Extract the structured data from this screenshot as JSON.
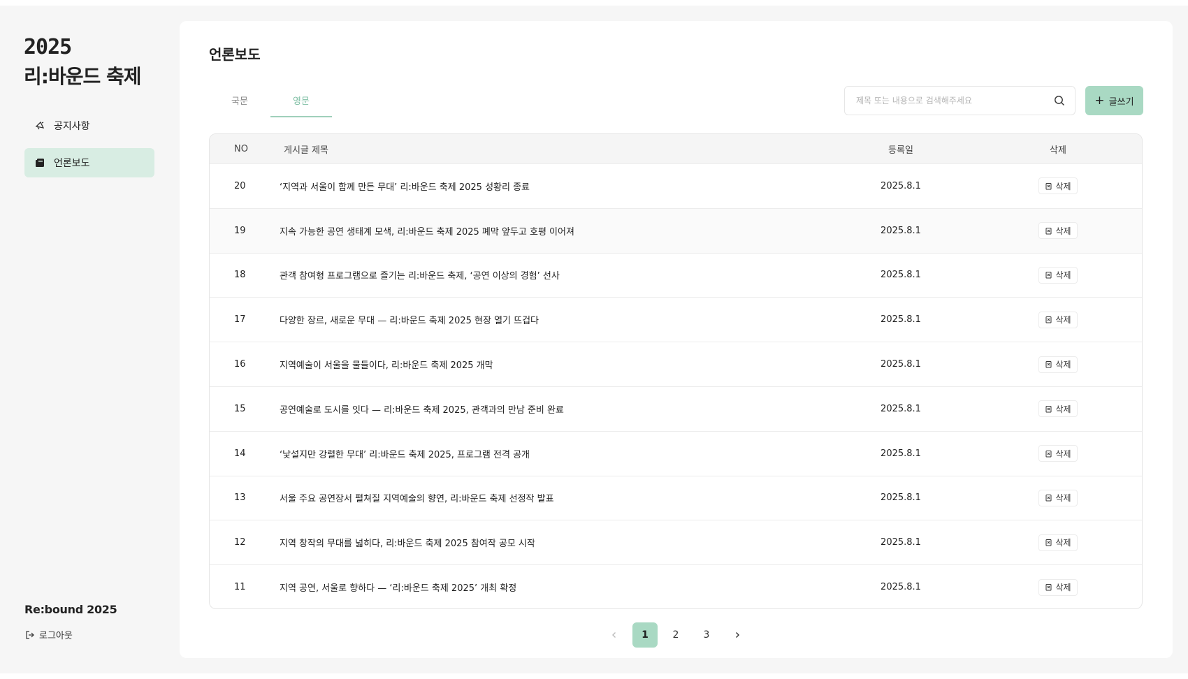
{
  "sidebar": {
    "logo_year": "2025",
    "logo_title": "리:바운드 축제",
    "items": [
      {
        "label": "공지사항",
        "icon": "megaphone-icon",
        "active": false
      },
      {
        "label": "언론보도",
        "icon": "press-icon",
        "active": true
      }
    ],
    "brand": "Re:bound 2025",
    "logout_label": "로그아웃"
  },
  "main": {
    "title": "언론보도",
    "tabs": [
      {
        "label": "국문",
        "active": false
      },
      {
        "label": "영문",
        "active": true
      }
    ],
    "search": {
      "placeholder": "제목 또는 내용으로 검색해주세요",
      "value": ""
    },
    "write_label": "글쓰기",
    "table": {
      "headers": {
        "no": "NO",
        "title": "게시글 제목",
        "date": "등록일",
        "delete": "삭제"
      },
      "delete_label": "삭제",
      "rows": [
        {
          "no": "20",
          "title": "‘지역과 서울이 함께 만든 무대’ 리:바운드 축제 2025 성황리 종료",
          "date": "2025.8.1"
        },
        {
          "no": "19",
          "title": "지속 가능한 공연 생태계 모색, 리:바운드 축제 2025 폐막 앞두고 호평 이어져",
          "date": "2025.8.1"
        },
        {
          "no": "18",
          "title": "관객 참여형 프로그램으로 즐기는 리:바운드 축제, ‘공연 이상의 경험’ 선사",
          "date": "2025.8.1"
        },
        {
          "no": "17",
          "title": "다양한 장르, 새로운 무대 — 리:바운드 축제 2025 현장 열기 뜨겁다",
          "date": "2025.8.1"
        },
        {
          "no": "16",
          "title": "지역예술이 서울을 물들이다, 리:바운드 축제 2025 개막",
          "date": "2025.8.1"
        },
        {
          "no": "15",
          "title": "공연예술로 도시를 잇다 — 리:바운드 축제 2025, 관객과의 만남 준비 완료",
          "date": "2025.8.1"
        },
        {
          "no": "14",
          "title": "‘낯설지만 강렬한 무대’ 리:바운드 축제 2025, 프로그램 전격 공개",
          "date": "2025.8.1"
        },
        {
          "no": "13",
          "title": "서울 주요 공연장서 펼쳐질 지역예술의 향연, 리:바운드 축제 선정작 발표",
          "date": "2025.8.1"
        },
        {
          "no": "12",
          "title": "지역 창작의 무대를 넓히다, 리:바운드 축제 2025 참여작 공모 시작",
          "date": "2025.8.1"
        },
        {
          "no": "11",
          "title": "지역 공연, 서울로 향하다 — ‘리:바운드 축제 2025’ 개최 확정",
          "date": "2025.8.1"
        }
      ]
    },
    "pagination": {
      "pages": [
        "1",
        "2",
        "3"
      ],
      "current": "1"
    }
  },
  "colors": {
    "accent": "#a9d9c3",
    "active_nav": "#d8ede3",
    "tab_active": "#7fbfa4"
  }
}
